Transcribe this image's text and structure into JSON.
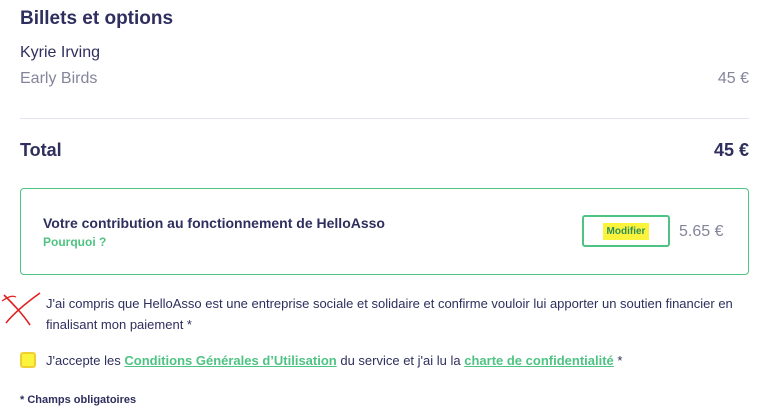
{
  "summary": {
    "title": "Billets et options",
    "attendee": "Kyrie Irving",
    "ticket_name": "Early Birds",
    "ticket_price": "45 €",
    "total_label": "Total",
    "total_value": "45 €"
  },
  "contribution": {
    "title": "Votre contribution au fonctionnement de HelloAsso",
    "why_link": "Pourquoi ?",
    "modify_button": "Modifier",
    "amount": "5.65 €"
  },
  "consent": {
    "acknowledge_text": "J'ai compris que HelloAsso est une entreprise sociale et solidaire et confirme vouloir lui apporter un soutien financier en finalisant mon paiement *",
    "accept_prefix": "J'accepte les ",
    "cgu_link": "Conditions Générales d’Utilisation",
    "accept_middle": " du service et j'ai lu la ",
    "privacy_link": "charte de confidentialité",
    "accept_suffix": " *"
  },
  "required_note": "* Champs obligatoires",
  "colors": {
    "primary_text": "#2e2f5e",
    "muted_text": "#84859b",
    "accent_green": "#4fc383",
    "highlight_yellow": "#fcf33d",
    "annotation_red": "#e02020"
  }
}
